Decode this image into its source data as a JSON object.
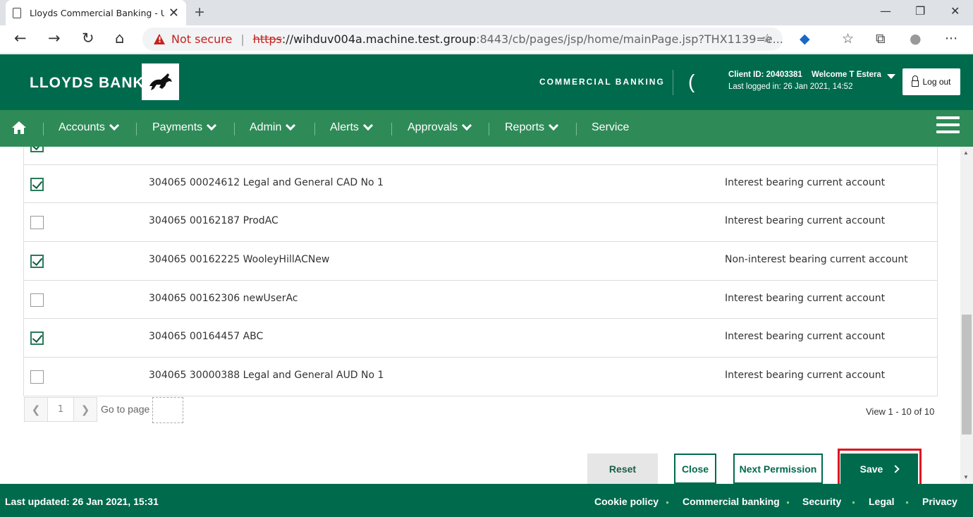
{
  "browser": {
    "tab_title": "Lloyds Commercial Banking - User",
    "not_secure": "Not secure",
    "url_scheme": "https",
    "url_host": "://wihduv004a.machine.test.group",
    "url_path": ":8443/cb/pages/jsp/home/mainPage.jsp?THX1139=e..."
  },
  "header": {
    "brand": "LLOYDS BANK",
    "section": "COMMERCIAL BANKING",
    "client_id": "Client ID: 20403381",
    "welcome": "Welcome T Estera",
    "last_logged": "Last logged in: 26 Jan 2021, 14:52",
    "logout": "Log out"
  },
  "nav": {
    "items": [
      {
        "label": "Accounts"
      },
      {
        "label": "Payments"
      },
      {
        "label": "Admin"
      },
      {
        "label": "Alerts"
      },
      {
        "label": "Approvals"
      },
      {
        "label": "Reports"
      },
      {
        "label": "Service"
      }
    ]
  },
  "accounts": [
    {
      "name": "",
      "type": "",
      "checked": true
    },
    {
      "name": "304065 00024612 Legal and General CAD No 1",
      "type": "Interest bearing current account",
      "checked": true
    },
    {
      "name": "304065 00162187 ProdAC",
      "type": "Interest bearing current account",
      "checked": false
    },
    {
      "name": "304065 00162225 WooleyHillACNew",
      "type": "Non-interest bearing current account",
      "checked": true
    },
    {
      "name": "304065 00162306 newUserAc",
      "type": "Interest bearing current account",
      "checked": false
    },
    {
      "name": "304065 00164457 ABC",
      "type": "Interest bearing current account",
      "checked": true
    },
    {
      "name": "304065 30000388 Legal and General AUD No 1",
      "type": "Interest bearing current account",
      "checked": false
    }
  ],
  "pager": {
    "page": "1",
    "goto_label": "Go to page",
    "view_text": "View 1 - 10 of 10"
  },
  "actions": {
    "reset": "Reset",
    "close": "Close",
    "next": "Next Permission",
    "save": "Save"
  },
  "footer": {
    "updated": "Last updated: 26 Jan 2021, 15:31",
    "links": [
      "Cookie policy",
      "Commercial banking",
      "Security",
      "Legal",
      "Privacy"
    ]
  },
  "colors": {
    "brand_green": "#006a4d",
    "nav_green": "#2e8b57",
    "highlight_red": "#e0111e"
  }
}
